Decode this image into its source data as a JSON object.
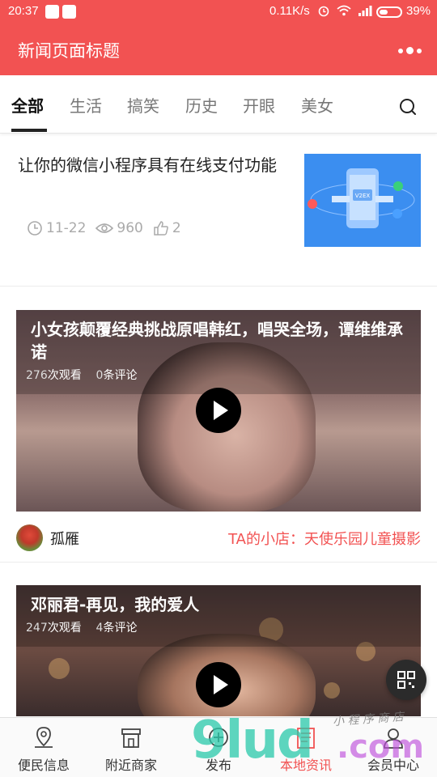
{
  "status_bar": {
    "time": "20:37",
    "network_speed": "0.11K/s",
    "battery": "39%"
  },
  "header": {
    "title": "新闻页面标题"
  },
  "tabs": [
    {
      "label": "全部",
      "active": true
    },
    {
      "label": "生活",
      "active": false
    },
    {
      "label": "搞笑",
      "active": false
    },
    {
      "label": "历史",
      "active": false
    },
    {
      "label": "开眼",
      "active": false
    },
    {
      "label": "美女",
      "active": false
    }
  ],
  "article": {
    "title": "让你的微信小程序具有在线支付功能",
    "date": "11-22",
    "views": "960",
    "likes": "2",
    "thumb_label": "V2EX"
  },
  "videos": [
    {
      "title": "小女孩颠覆经典挑战原唱韩红，唱哭全场，谭维维承诺",
      "views": "276",
      "views_suffix": "次观看",
      "comments": "0",
      "comments_suffix": "条评论"
    },
    {
      "title": "邓丽君-再见，我的爱人",
      "views": "247",
      "views_suffix": "次观看",
      "comments": "4",
      "comments_suffix": "条评论"
    }
  ],
  "shop_row": {
    "author": "孤雁",
    "shop_link": "TA的小店：天使乐园儿童摄影"
  },
  "bottom_nav": [
    {
      "label": "便民信息",
      "icon": "map-pin-icon"
    },
    {
      "label": "附近商家",
      "icon": "store-icon"
    },
    {
      "label": "发布",
      "icon": "plus-circle-icon"
    },
    {
      "label": "本地资讯",
      "icon": "news-icon",
      "active": true
    },
    {
      "label": "会员中心",
      "icon": "user-icon"
    }
  ],
  "watermark": {
    "big": "9lud",
    "com": ".com",
    "small": "小 程 序 商 店"
  },
  "colors": {
    "brand": "#f25252",
    "tab_active": "#111111"
  }
}
